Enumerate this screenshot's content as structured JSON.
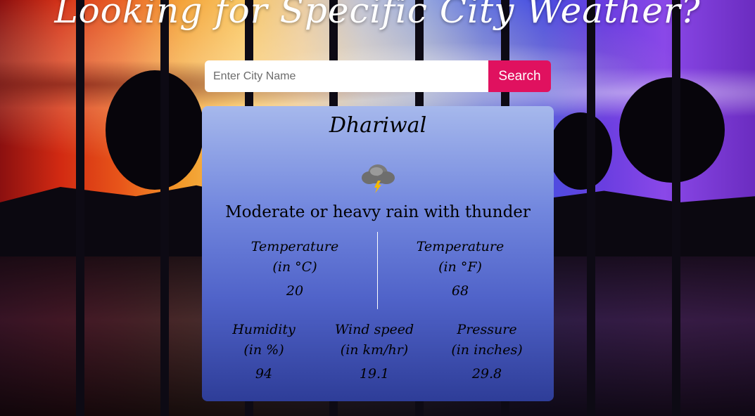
{
  "header": {
    "title": "Looking for Specific City Weather?"
  },
  "search": {
    "placeholder": "Enter City Name",
    "value": "",
    "button_label": "Search"
  },
  "weather": {
    "city": "Dhariwal",
    "icon": "thunder-rain-cloud-icon",
    "condition": "Moderate or heavy rain with thunder",
    "temp_c": {
      "label_line1": "Temperature",
      "label_line2": "(in °C)",
      "value": "20"
    },
    "temp_f": {
      "label_line1": "Temperature",
      "label_line2": "(in °F)",
      "value": "68"
    },
    "humidity": {
      "label_line1": "Humidity",
      "label_line2": "(in %)",
      "value": "94"
    },
    "wind": {
      "label_line1": "Wind speed",
      "label_line2": "(in km/hr)",
      "value": "19.1"
    },
    "pressure": {
      "label_line1": "Pressure",
      "label_line2": "(in inches)",
      "value": "29.8"
    }
  },
  "colors": {
    "search_button": "#e0115f",
    "card_top": "#a6b8ec",
    "card_bottom": "#2e3d98"
  }
}
